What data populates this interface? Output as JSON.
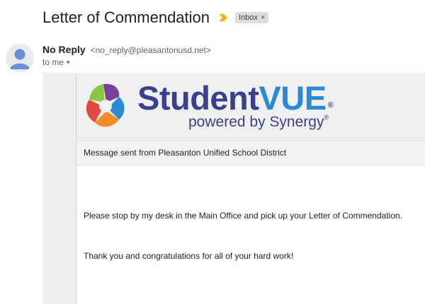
{
  "email": {
    "subject": "Letter of Commendation",
    "label": "Inbox",
    "label_remove": "×",
    "sender_name": "No Reply",
    "sender_email": "<no_reply@pleasantonusd.net>",
    "recipient": "to me",
    "recipient_caret": "▾"
  },
  "banner": {
    "brand_main": "Student",
    "brand_accent": "VUE",
    "brand_reg": "®",
    "tagline": "powered by Synergy",
    "tagline_reg": "®"
  },
  "body": {
    "district_line": "Message sent from Pleasanton Unified School District",
    "paragraph1": "Please stop by my desk in the Main Office and pick up your Letter of Commendation.",
    "paragraph2": "Thank you and congratulations for all of your hard work!"
  },
  "colors": {
    "importance": "#f4b400",
    "brand_dark": "#3b3f8f",
    "brand_light": "#2b8ad6"
  }
}
